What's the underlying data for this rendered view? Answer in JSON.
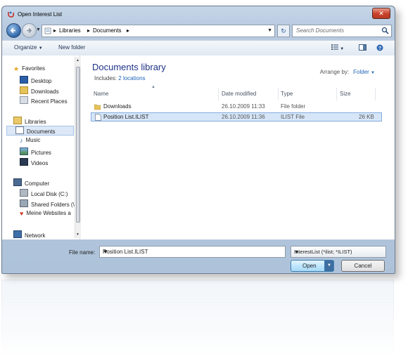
{
  "window": {
    "title": "Open Interest List"
  },
  "address": {
    "segments": [
      "Libraries",
      "Documents"
    ],
    "search_placeholder": "Search Documents"
  },
  "toolbar": {
    "organize": "Organize",
    "new_folder": "New folder"
  },
  "nav": {
    "favorites_header": "Favorites",
    "favorites": [
      "Desktop",
      "Downloads",
      "Recent Places"
    ],
    "libraries_header": "Libraries",
    "libraries": [
      "Documents",
      "Music",
      "Pictures",
      "Videos"
    ],
    "computer_header": "Computer",
    "computer": [
      "Local Disk (C:)",
      "Shared Folders (\\",
      "Meine Websites a"
    ],
    "network_header": "Network"
  },
  "library": {
    "title": "Documents library",
    "includes_label": "Includes:",
    "includes_link": "2 locations",
    "arrange_label": "Arrange by:",
    "arrange_value": "Folder"
  },
  "columns": {
    "name": "Name",
    "date": "Date modified",
    "type": "Type",
    "size": "Size"
  },
  "files": [
    {
      "name": "Downloads",
      "date": "26.10.2009 11:33",
      "type": "File folder",
      "size": ""
    },
    {
      "name": "Position List.ILIST",
      "date": "26.10.2009 11:36",
      "type": "ILIST File",
      "size": "26 KB"
    }
  ],
  "footer": {
    "file_name_label": "File name:",
    "file_name_value": "Position List.ILIST",
    "file_type": "InterestList (*ilist; *ILIST)",
    "open_label": "Open",
    "cancel_label": "Cancel"
  }
}
